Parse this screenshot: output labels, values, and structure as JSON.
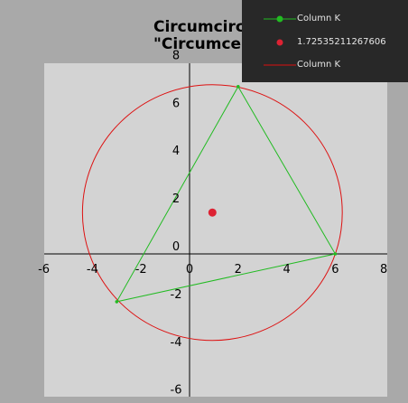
{
  "chart_data": {
    "type": "scatter",
    "title_lines": [
      "Circumcircle",
      "\"Circumcenter\""
    ],
    "xlim": [
      -6,
      8
    ],
    "ylim": [
      -6,
      8
    ],
    "x_ticks": [
      -6,
      -4,
      -2,
      0,
      2,
      4,
      6,
      8
    ],
    "y_ticks": [
      8,
      6,
      4,
      2,
      0,
      -2,
      -4,
      -6
    ],
    "grid": false,
    "legend_position": "top-right",
    "series": [
      {
        "name": "Column K",
        "style": "line-markers",
        "color": "#22bb22",
        "points": [
          [
            2,
            7
          ],
          [
            6,
            0
          ],
          [
            -3,
            -2
          ],
          [
            2,
            7
          ]
        ]
      },
      {
        "name": "1.72535211267606",
        "style": "marker",
        "color": "#dd2233",
        "points": [
          [
            0.94,
            1.73
          ]
        ]
      },
      {
        "name": "Column K",
        "style": "circle",
        "color": "#dd1111",
        "center": [
          0.94,
          1.73
        ],
        "radius": 5.35
      }
    ]
  }
}
